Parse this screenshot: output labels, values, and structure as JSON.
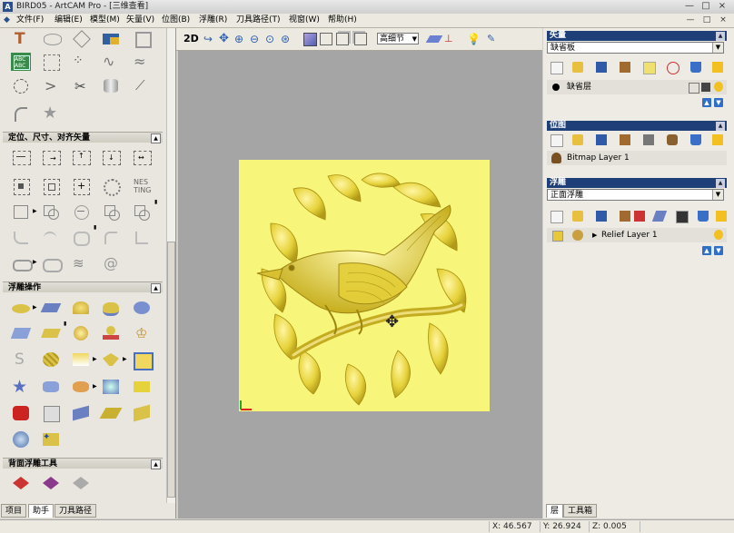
{
  "window": {
    "title": "BIRD05 - ArtCAM Pro - [三维查看]",
    "controls": [
      "—",
      "□",
      "×"
    ],
    "mdi_controls": [
      "—",
      "□",
      "×"
    ]
  },
  "menu": [
    "文件(F)",
    "编辑(E)",
    "模型(M)",
    "矢量(V)",
    "位图(B)",
    "浮雕(R)",
    "刀具路径(T)",
    "视窗(W)",
    "帮助(H)"
  ],
  "left_panel": {
    "sections": [
      {
        "id": "align",
        "label": "定位、尺寸、对齐矢量"
      },
      {
        "id": "relief_ops",
        "label": "浮雕操作"
      },
      {
        "id": "back_relief",
        "label": "背面浮雕工具"
      }
    ],
    "tabs": [
      "项目",
      "助手",
      "刀具路径"
    ],
    "active_tab": 1
  },
  "view_toolbar": {
    "mode": "2D",
    "quality_select": "高细节"
  },
  "right_panel": {
    "vector": {
      "header": "矢量",
      "select": "缺省板",
      "layer": "缺省层"
    },
    "bitmap": {
      "header": "位图",
      "layer": "Bitmap Layer 1"
    },
    "relief": {
      "header": "浮雕",
      "select": "正面浮雕",
      "layer": "Relief Layer 1"
    },
    "tabs": [
      "层",
      "工具箱"
    ],
    "active_tab": 0
  },
  "status": {
    "x": "X: 46.567",
    "y": "Y: 26.924",
    "z": "Z: 0.005"
  },
  "colors": {
    "relief_gold": "#e6d23a",
    "canvas_bg": "#f7f57a",
    "viewport_bg": "#a5a5a5",
    "header_blue": "#1f3f78"
  }
}
